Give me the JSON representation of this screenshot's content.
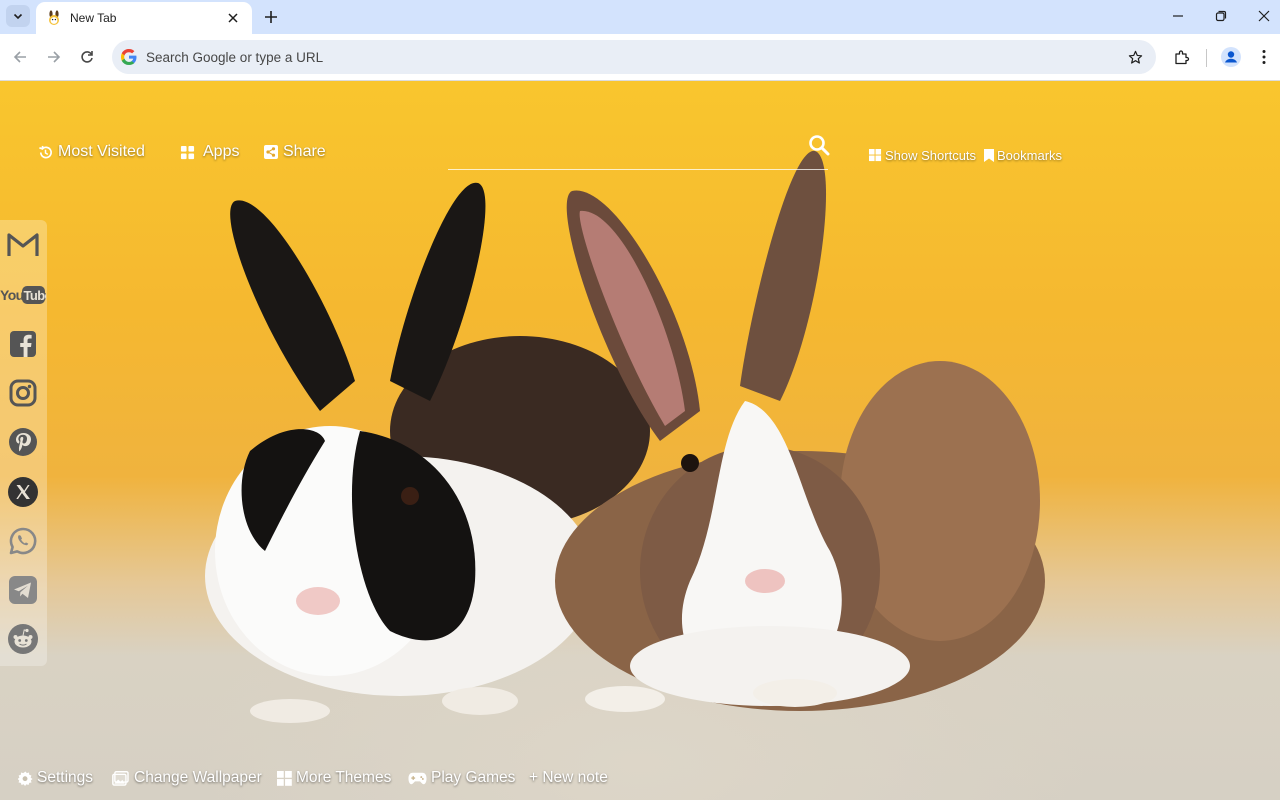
{
  "browser": {
    "tab": {
      "title": "New Tab"
    },
    "omnibox": {
      "placeholder": "Search Google or type a URL"
    }
  },
  "newtab": {
    "top_links": {
      "most_visited": "Most Visited",
      "apps": "Apps",
      "share": "Share",
      "show_shortcuts": "Show Shortcuts",
      "bookmarks": "Bookmarks"
    },
    "social": [
      {
        "name": "gmail-icon"
      },
      {
        "name": "youtube-icon",
        "label": "YouTube"
      },
      {
        "name": "facebook-icon"
      },
      {
        "name": "instagram-icon"
      },
      {
        "name": "pinterest-icon"
      },
      {
        "name": "x-icon"
      },
      {
        "name": "whatsapp-icon"
      },
      {
        "name": "telegram-icon"
      },
      {
        "name": "reddit-icon"
      }
    ],
    "bottom_links": {
      "settings": "Settings",
      "change_wallpaper": "Change Wallpaper",
      "more_themes": "More Themes",
      "play_games": "Play Games",
      "new_note": "+ New note"
    }
  },
  "colors": {
    "tabstrip": "#d3e3fd",
    "omnibox": "#e9eef6",
    "wallpaper_top": "#f9c62e",
    "wallpaper_floor": "#d6d0c4"
  }
}
